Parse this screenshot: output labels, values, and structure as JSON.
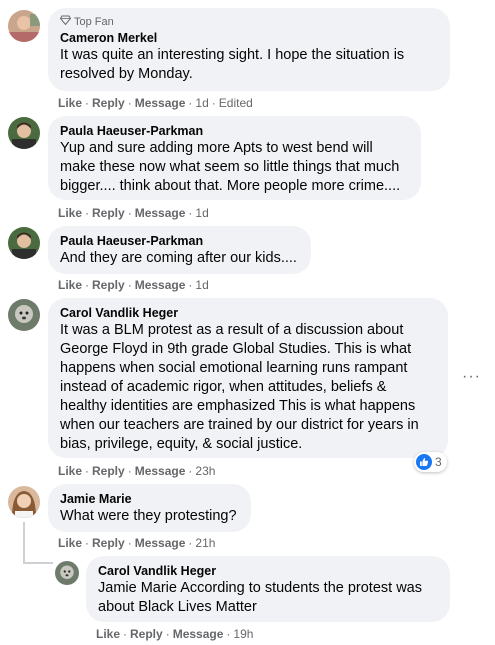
{
  "comments": [
    {
      "badge": "Top Fan",
      "author": "Cameron Merkel",
      "text": "It was quite an interesting sight. I hope the situation is resolved by Monday.",
      "actions": {
        "like": "Like",
        "reply": "Reply",
        "message": "Message",
        "time": "1d",
        "edited": "Edited"
      }
    },
    {
      "author": "Paula Haeuser-Parkman",
      "text": "Yup and sure adding more Apts to west bend will make these now what seem so little things that much bigger.... think about that. More people more crime....",
      "actions": {
        "like": "Like",
        "reply": "Reply",
        "message": "Message",
        "time": "1d"
      }
    },
    {
      "author": "Paula Haeuser-Parkman",
      "text": "And they are coming after our kids....",
      "actions": {
        "like": "Like",
        "reply": "Reply",
        "message": "Message",
        "time": "1d"
      }
    },
    {
      "author": "Carol Vandlik Heger",
      "text": "It was a BLM protest as a result of a discussion about George Floyd in 9th grade Global Studies. This is what happens when social emotional learning runs rampant instead of academic rigor, when attitudes, beliefs & healthy identities are emphasized This is what happens when our teachers are trained by our district for years in bias, privilege, equity, & social justice.",
      "actions": {
        "like": "Like",
        "reply": "Reply",
        "message": "Message",
        "time": "23h"
      },
      "reaction_count": "3"
    },
    {
      "author": "Jamie Marie",
      "text": "What were they protesting?",
      "actions": {
        "like": "Like",
        "reply": "Reply",
        "message": "Message",
        "time": "21h"
      }
    },
    {
      "author": "Carol Vandlik Heger",
      "text": "Jamie Marie According to students the protest was about Black Lives Matter",
      "actions": {
        "like": "Like",
        "reply": "Reply",
        "message": "Message",
        "time": "19h"
      }
    }
  ],
  "more_options": "···",
  "colors": {
    "bubble": "#f0f2f5",
    "meta": "#65676b",
    "like_blue": "#1877f2"
  }
}
